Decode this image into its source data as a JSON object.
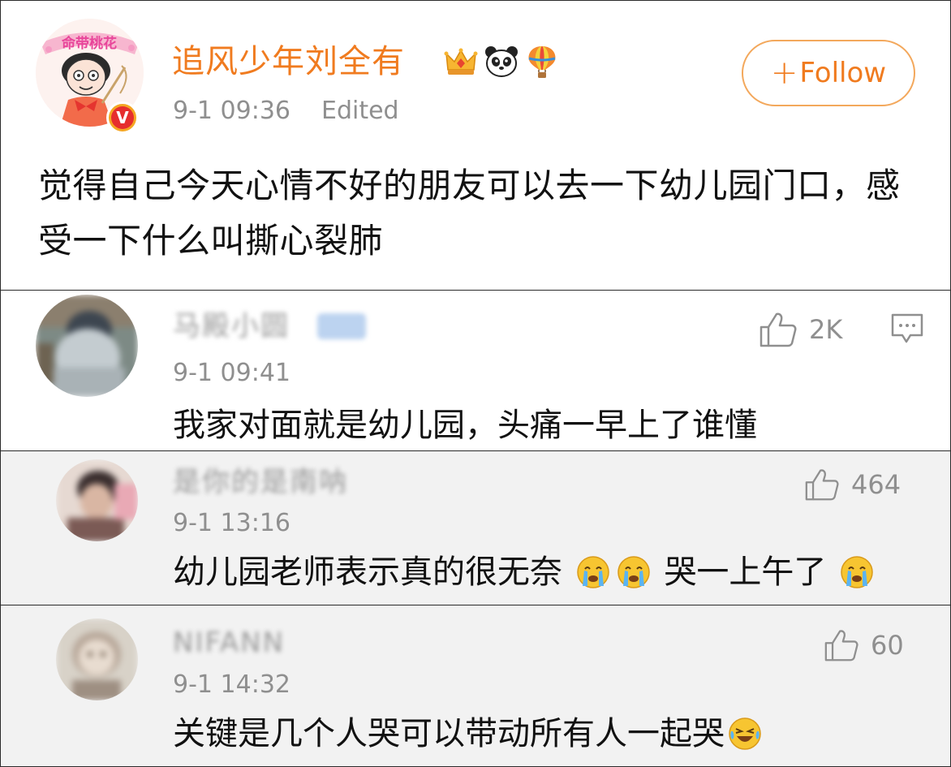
{
  "post": {
    "author": "追风少年刘全有",
    "badges": [
      "crown-badge-icon",
      "panda-badge-icon",
      "balloon-badge-icon"
    ],
    "avatar_banner_text": "命带桃花",
    "verify_mark": "V",
    "time": "9-1 09:36",
    "edited_label": "Edited",
    "follow_plus": "+",
    "follow_label": "Follow",
    "text": "觉得自己今天心情不好的朋友可以去一下幼儿园门口，感受一下什么叫撕心裂肺",
    "colors": {
      "author_name": "#f07b1f",
      "follow_border": "#f3a85c",
      "verify": "#e62e2e"
    }
  },
  "comments": [
    {
      "name": "马殿小圆",
      "time": "9-1 09:41",
      "likes": "2K",
      "text_parts": [
        "我家对面就是幼儿园，头痛一早上了谁懂"
      ],
      "has_reply_icon": true
    },
    {
      "name": "是你的是南呐",
      "time": "9-1 13:16",
      "likes": "464",
      "text_parts": [
        "幼儿园老师表示真的很无奈",
        "哭一上午了"
      ],
      "emojis": [
        "crying-emoji-icon",
        "crying-emoji-icon",
        "crying-emoji-icon"
      ]
    },
    {
      "name": "NIFANN",
      "time": "9-1 14:32",
      "likes": "60",
      "text_parts": [
        "关键是几个人哭可以带动所有人一起哭"
      ],
      "emojis": [
        "laugh-cry-emoji-icon"
      ]
    }
  ]
}
